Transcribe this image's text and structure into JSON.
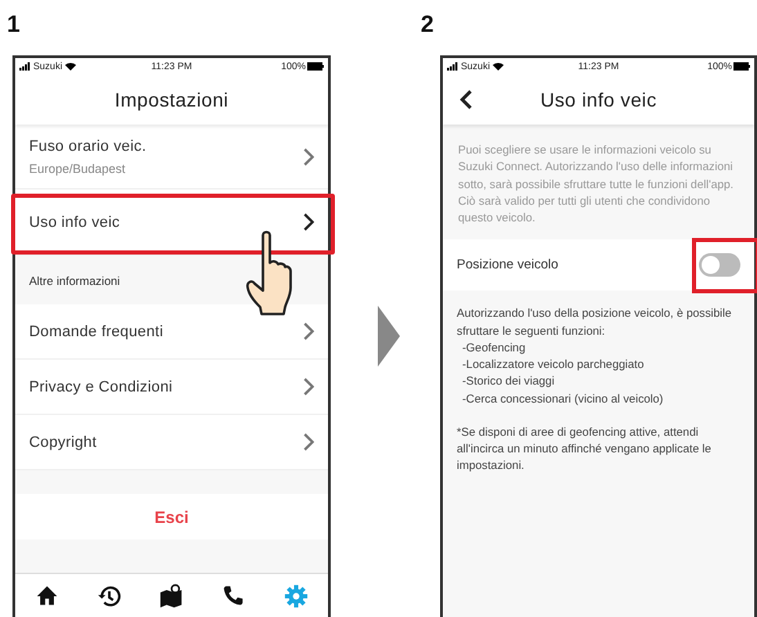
{
  "steps": [
    {
      "number": "1",
      "status_bar": {
        "carrier": "Suzuki",
        "time": "11:23 PM",
        "battery": "100%"
      },
      "title": "Impostazioni",
      "items": [
        {
          "kind": "setting",
          "label": "Fuso orario veic.",
          "value": "Europe/Budapest",
          "highlighted": false
        },
        {
          "kind": "setting",
          "label": "Uso info veic",
          "highlighted": true
        },
        {
          "kind": "section",
          "label": "Altre informazioni"
        },
        {
          "kind": "setting",
          "label": "Domande frequenti",
          "highlighted": false
        },
        {
          "kind": "setting",
          "label": "Privacy e Condizioni",
          "highlighted": false
        },
        {
          "kind": "setting",
          "label": "Copyright",
          "highlighted": false
        },
        {
          "kind": "spacer"
        },
        {
          "kind": "logout",
          "label": "Esci"
        }
      ],
      "tabs": [
        {
          "selected": false
        },
        {
          "selected": false
        },
        {
          "selected": false
        },
        {
          "selected": false
        },
        {
          "selected": true
        }
      ]
    },
    {
      "number": "2",
      "status_bar": {
        "carrier": "Suzuki",
        "time": "11:23 PM",
        "battery": "100%"
      },
      "title": "Uso info veic",
      "description": "Puoi scegliere se usare le informazioni veicolo su Suzuki Connect. Autorizzando l'uso delle informazioni sotto, sarà possibile sfruttare tutte le funzioni dell'app. Ciò sarà valido per tutti gli utenti che condividono questo veicolo.",
      "vehicle_position": {
        "label": "Posizione veicolo",
        "on": false,
        "highlighted": true
      },
      "note_intro": "Autorizzando l'uso della posizione veicolo, è possibile sfruttare le seguenti funzioni:",
      "features": [
        "-Geofencing",
        "-Localizzatore veicolo parcheggiato",
        "-Storico dei viaggi",
        "-Cerca concessionari (vicino al veicolo)"
      ],
      "footnote": "*Se disponi di aree di geofencing attive, attendi all'incirca un minuto affinché vengano applicate le impostazioni."
    }
  ]
}
